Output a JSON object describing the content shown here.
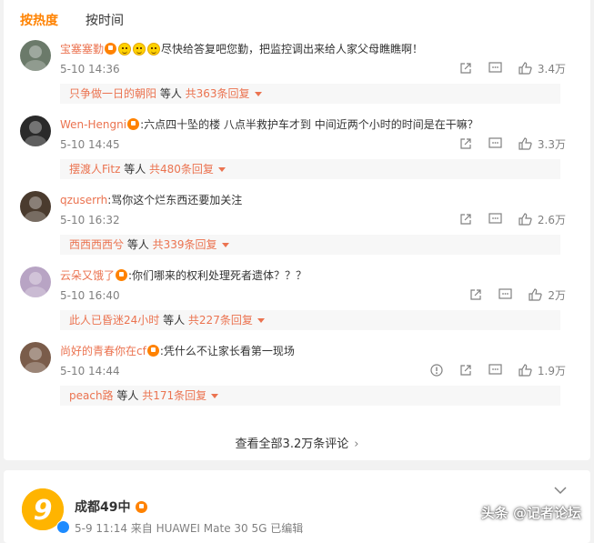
{
  "tabs": {
    "hot": "按热度",
    "time": "按时间"
  },
  "colors": {
    "accent": "#ff8200",
    "username": "#eb7350",
    "meta": "#808080"
  },
  "comments": [
    {
      "user": "宝塞塞勤",
      "text": "尽快给答复吧您勤，把监控调出来给人家父母瞧瞧啊！",
      "emojis": 3,
      "time": "5-10 14:36",
      "likes": "3.4万",
      "reply_user": "只争做一日的朝阳",
      "reply_mid": " 等人 ",
      "reply_count": "共363条回复",
      "report": false
    },
    {
      "user": "Wen-Hengni",
      "text": ":六点四十坠的楼 八点半救护车才到 中间近两个小时的时间是在干嘛？",
      "emojis": 0,
      "time": "5-10 14:45",
      "likes": "3.3万",
      "reply_user": "摆渡人Fitz",
      "reply_mid": " 等人 ",
      "reply_count": "共480条回复",
      "report": false
    },
    {
      "user": "qzuserrh",
      "text": ":骂你这个烂东西还要加关注",
      "emojis": 0,
      "time": "5-10 16:32",
      "likes": "2.6万",
      "reply_user": "西西西西兮",
      "reply_mid": " 等人 ",
      "reply_count": "共339条回复",
      "report": false
    },
    {
      "user": "云朵又饿了",
      "text": ":你们哪来的权利处理死者遗体？？？",
      "emojis": 0,
      "time": "5-10 16:40",
      "likes": "2万",
      "reply_user": "此人已昏迷24小时",
      "reply_mid": " 等人 ",
      "reply_count": "共227条回复",
      "report": false
    },
    {
      "user": "尚好的青春你在cf",
      "text": ":凭什么不让家长看第一现场",
      "emojis": 0,
      "time": "5-10 14:44",
      "likes": "1.9万",
      "reply_user": "peach路",
      "reply_mid": " 等人 ",
      "reply_count": "共171条回复",
      "report": true
    }
  ],
  "view_all": "查看全部3.2万条评论",
  "feed": {
    "name": "成都49中",
    "meta": "5-9 11:14 来自 HUAWEI Mate 30 5G 已编辑"
  },
  "watermark": "头条 @记者论坛",
  "icons": [
    "share-icon",
    "comment-icon",
    "like-icon",
    "report-icon",
    "chevron-right-icon",
    "chevron-down-icon"
  ]
}
